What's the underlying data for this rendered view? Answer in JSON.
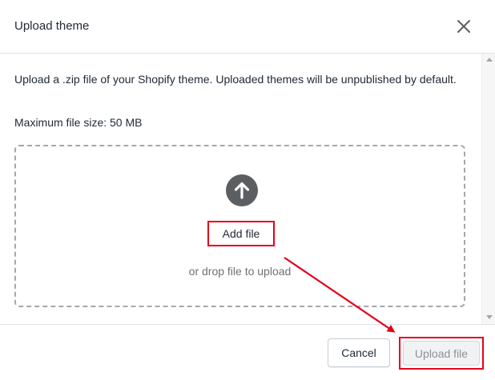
{
  "modal": {
    "title": "Upload theme",
    "close_icon": "close-icon"
  },
  "body": {
    "description": "Upload a .zip file of your Shopify theme. Uploaded themes will be unpublished by default.",
    "max_size": "Maximum file size: 50 MB",
    "dropzone": {
      "icon": "upload-arrow-icon",
      "add_file_label": "Add file",
      "drop_hint": "or drop file to upload"
    }
  },
  "footer": {
    "cancel_label": "Cancel",
    "upload_label": "Upload file",
    "upload_disabled": true
  },
  "annotations": {
    "highlight_color": "#e4001b",
    "arrow": "from-add-file-to-upload-file"
  }
}
